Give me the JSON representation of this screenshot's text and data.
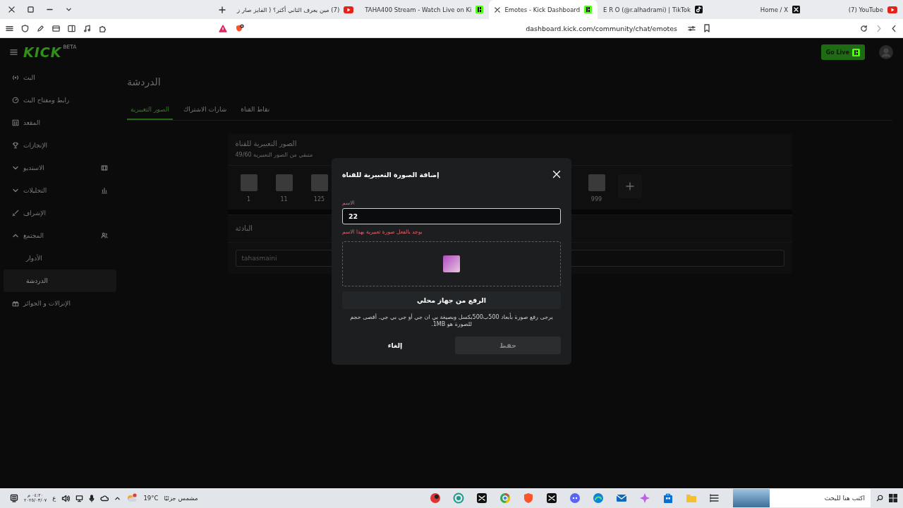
{
  "browser": {
    "tabs": [
      {
        "title": "(7) YouTube",
        "kind": "play",
        "selected": false
      },
      {
        "title": "Home / X",
        "kind": "x",
        "selected": false
      },
      {
        "title": "E R O (@r.alhadrami) | TikTok",
        "kind": "note",
        "selected": false
      },
      {
        "title": "Emotes - Kick Dashboard",
        "kind": "k",
        "selected": true
      },
      {
        "title": "TAHA400 Stream - Watch Live on Ki",
        "kind": "k",
        "selected": false
      },
      {
        "title": "(7) مين يعرف الثاني أكثر؟ ( الفايز صار ز",
        "kind": "play",
        "selected": false
      }
    ],
    "address": "dashboard.kick.com/community/chat/emotes"
  },
  "topbar": {
    "logo": "KICK",
    "logo_badge": "BETA",
    "go_live": "Go Live"
  },
  "sidebar": {
    "items": [
      {
        "label": "البث",
        "kind": "link",
        "selected": false
      },
      {
        "label": "رابط ومفتاح البث",
        "kind": "link",
        "selected": false
      },
      {
        "label": "المقعد",
        "kind": "link",
        "selected": false
      },
      {
        "label": "الإنجازات",
        "kind": "link",
        "selected": false
      },
      {
        "label": "الاستديو",
        "kind": "group",
        "selected": false,
        "expanded": false
      },
      {
        "label": "التحليلات",
        "kind": "group",
        "selected": false,
        "expanded": false
      },
      {
        "label": "الإشراف",
        "kind": "link",
        "selected": false
      },
      {
        "label": "المجتمع",
        "kind": "group",
        "selected": false,
        "expanded": true,
        "children": [
          {
            "label": "الأدوار",
            "selected": false
          },
          {
            "label": "الدردشة",
            "selected": true
          }
        ]
      },
      {
        "label": "الإنزالات و الجوائز",
        "kind": "link",
        "selected": false
      }
    ]
  },
  "page": {
    "title": "الدردشة",
    "tabs": [
      {
        "label": "نقاط القناة",
        "selected": false
      },
      {
        "label": "شارات الاشتراك",
        "selected": false
      },
      {
        "label": "الصور التعبيرية",
        "selected": true
      }
    ]
  },
  "emotes_card": {
    "title": "الصور التعبيرية للقناة",
    "subtitle": "متبقي من الصور التعبيرية 49/60",
    "emotes": [
      {
        "name": "999"
      },
      {
        "name": "125"
      },
      {
        "name": "11"
      },
      {
        "name": "1"
      }
    ]
  },
  "prefix": {
    "title": "البادئة",
    "value": "tahasmaini"
  },
  "modal": {
    "title": "إضافة الصورة التعبيرية للقناة",
    "name_label": "الاسم",
    "name_value": "22",
    "error": "يوجد بالفعل صورة تعبيرية بهذا الاسم",
    "upload_button": "الرفع من جهاز محلي",
    "help": "يرجى رفع صورة بأبعاد 500ب500بكسل وبصيغة بي ان جي أو جي بي جي. أقصى حجم للصورة هو 1MB.",
    "cancel": "إلغاء",
    "save": "حفظ",
    "save_disabled": true
  },
  "taskbar": {
    "time": "٠٤:٢٠ م",
    "date": "٢٠٢٥/٠٣/٠٧",
    "language": "ع",
    "temperature": "19°C",
    "weather": "مشمس جزئيًا",
    "search_placeholder": "اكتب هنا للبحث"
  }
}
